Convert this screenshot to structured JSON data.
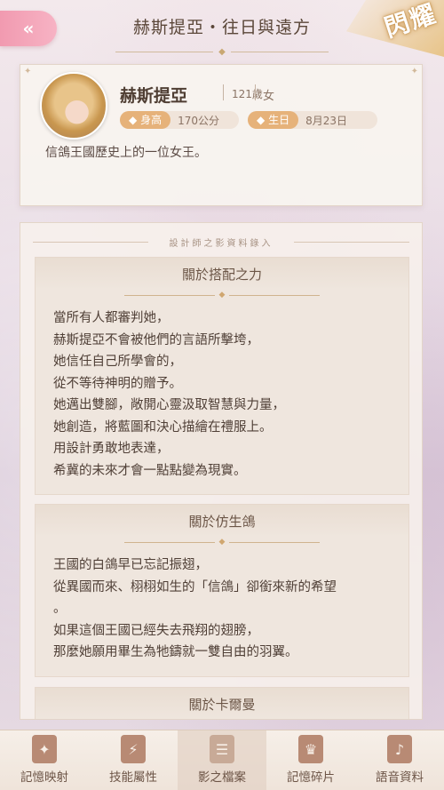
{
  "header": {
    "title": "赫斯提亞・往日與遠方",
    "back_icon": "double-chevron-left-icon",
    "badge_text": "閃耀"
  },
  "profile": {
    "name": "赫斯提亞",
    "age": "121歲",
    "gender": "女",
    "height_label": "身高",
    "height_value": "170公分",
    "birthday_label": "生日",
    "birthday_value": "8月23日",
    "bio": "信鴿王國歷史上的一位女王。"
  },
  "records": {
    "title": "設計師之影資料錄入",
    "sections": [
      {
        "heading": "關於搭配之力",
        "body": "當所有人都審判她，\n赫斯提亞不會被他們的言語所擊垮，\n她信任自己所學會的，\n從不等待神明的贈予。\n她邁出雙腳，敞開心靈汲取智慧與力量，\n她創造，將藍圖和決心描繪在禮服上。\n用設計勇敢地表達，\n希冀的未來才會一點點變為現實。"
      },
      {
        "heading": "關於仿生鴿",
        "body": "王國的白鴿早已忘記振翅，\n從異國而來、栩栩如生的「信鴿」卻銜來新的希望\n。\n如果這個王國已經失去飛翔的翅膀，\n那麼她願用畢生為牠鑄就一雙自由的羽翼。"
      },
      {
        "heading": "關於卡爾曼",
        "body": ""
      }
    ]
  },
  "nav": [
    {
      "label": "記憶映射",
      "icon": "memory-card-icon",
      "active": false
    },
    {
      "label": "技能屬性",
      "icon": "skill-shield-icon",
      "active": false
    },
    {
      "label": "影之檔案",
      "icon": "file-document-icon",
      "active": true
    },
    {
      "label": "記憶碎片",
      "icon": "dress-icon",
      "active": false
    },
    {
      "label": "語音資料",
      "icon": "voice-phone-icon",
      "active": false
    }
  ]
}
